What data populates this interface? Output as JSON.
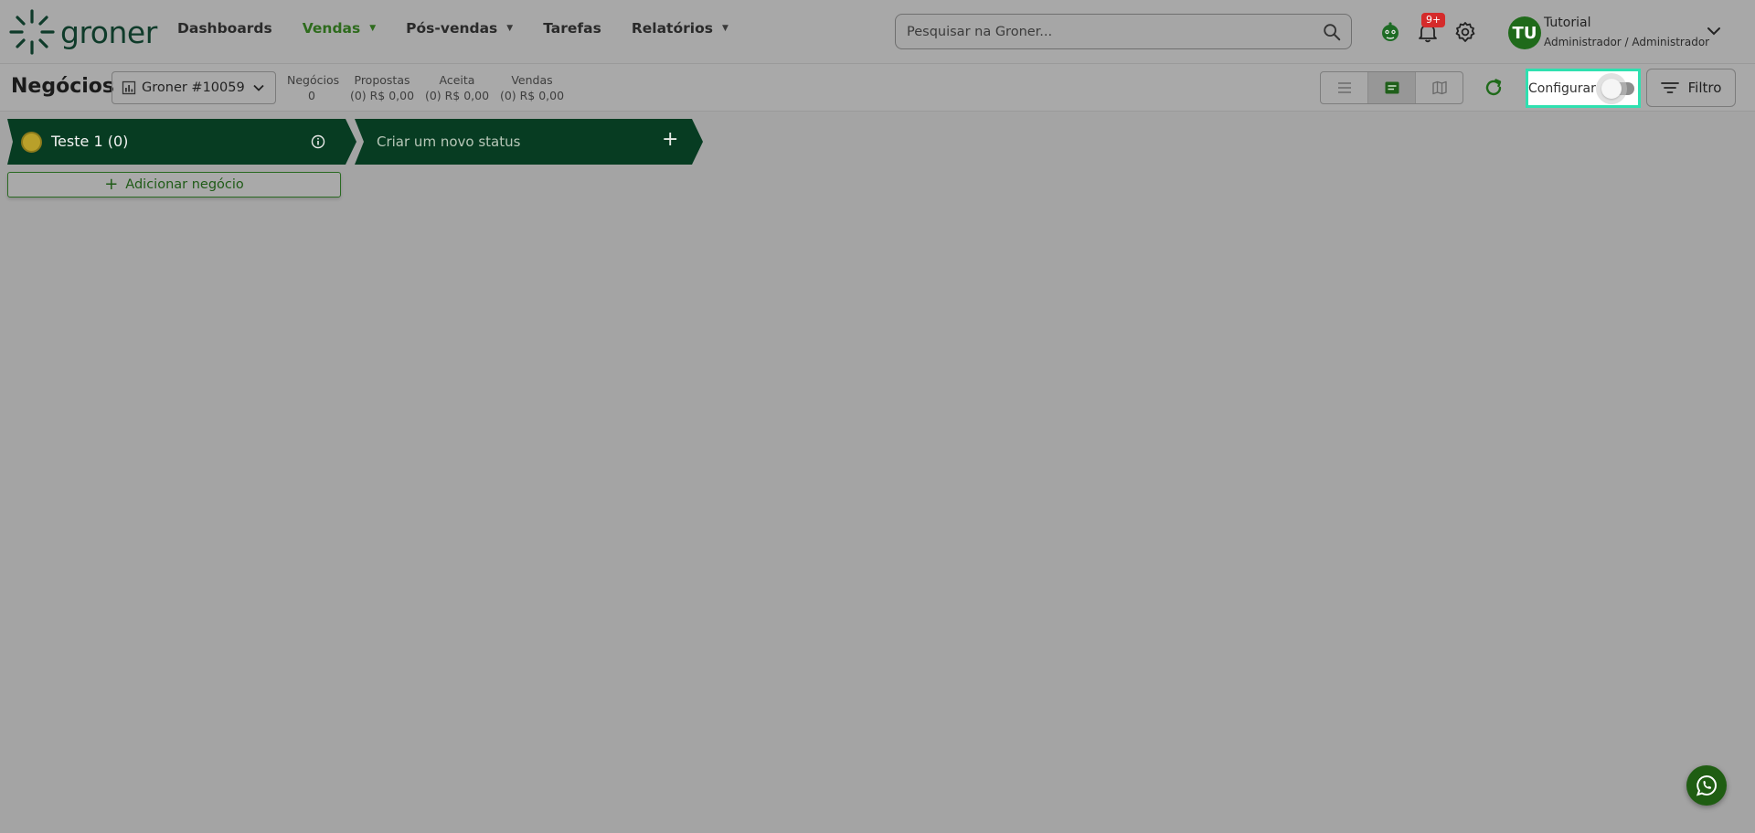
{
  "brand": {
    "name": "groner"
  },
  "nav": {
    "items": [
      {
        "label": "Dashboards",
        "has_caret": false
      },
      {
        "label": "Vendas",
        "has_caret": true,
        "active": true
      },
      {
        "label": "Pós-vendas",
        "has_caret": true
      },
      {
        "label": "Tarefas",
        "has_caret": false
      },
      {
        "label": "Relatórios",
        "has_caret": true
      }
    ]
  },
  "search": {
    "placeholder": "Pesquisar na Groner..."
  },
  "notifications": {
    "badge": "9+"
  },
  "user": {
    "initials": "TU",
    "name": "Tutorial",
    "role": "Administrador / Administrador"
  },
  "subheader": {
    "title": "Negócios",
    "pipeline": "Groner #10059",
    "stats": [
      {
        "label": "Negócios",
        "value": "0"
      },
      {
        "label": "Propostas",
        "value": "(0) R$ 0,00"
      },
      {
        "label": "Aceita",
        "value": "(0) R$ 0,00"
      },
      {
        "label": "Vendas",
        "value": "(0) R$ 0,00"
      }
    ],
    "config_label": "Configurar",
    "config_enabled": false,
    "filter_label": "Filtro"
  },
  "board": {
    "statuses": [
      {
        "title": "Teste 1 (0)"
      }
    ],
    "new_status_label": "Criar um novo status",
    "add_deal_label": "Adicionar negócio"
  },
  "colors": {
    "brand_green": "#0a3a20",
    "accent_green": "#2e6b1d",
    "highlight": "#2fe0b0",
    "badge_red": "#d52b2b"
  }
}
